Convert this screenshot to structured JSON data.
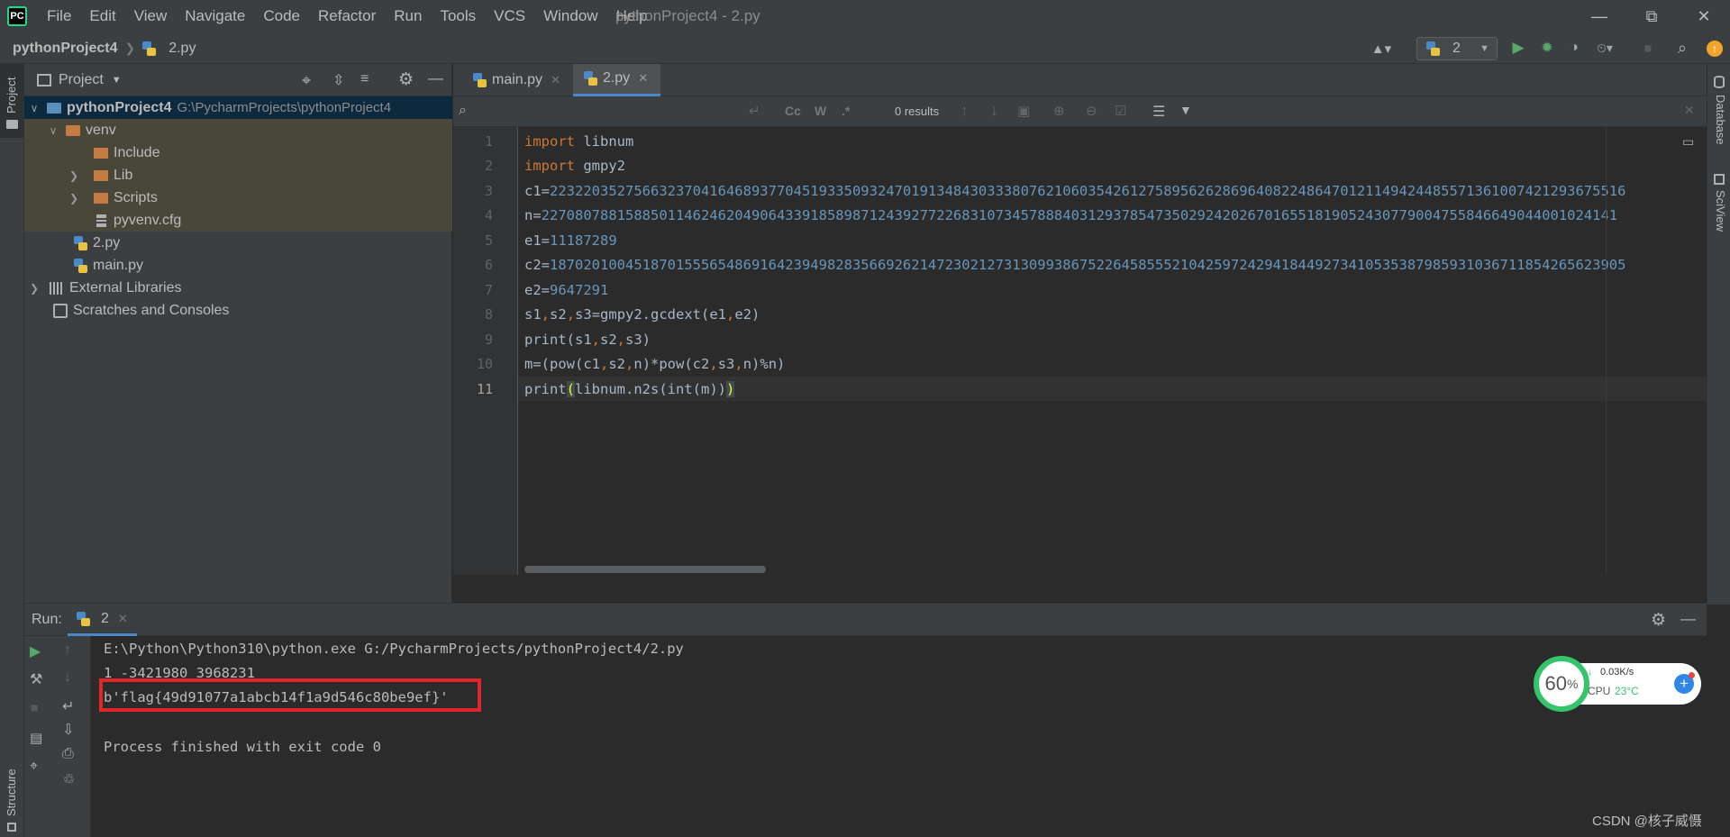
{
  "menu": [
    "File",
    "Edit",
    "View",
    "Navigate",
    "Code",
    "Refactor",
    "Run",
    "Tools",
    "VCS",
    "Window",
    "Help"
  ],
  "window_title": "pythonProject4 - 2.py",
  "breadcrumb": {
    "project": "pythonProject4",
    "file": "2.py"
  },
  "run_config": "2",
  "left_tabs": {
    "project": "Project",
    "structure": "Structure"
  },
  "right_tabs": {
    "database": "Database",
    "sciview": "SciView"
  },
  "project_panel": {
    "title": "Project",
    "tree": [
      {
        "label": "pythonProject4",
        "path": "G:\\PycharmProjects\\pythonProject4"
      },
      {
        "label": "venv"
      },
      {
        "label": "Include"
      },
      {
        "label": "Lib"
      },
      {
        "label": "Scripts"
      },
      {
        "label": "pyvenv.cfg"
      },
      {
        "label": "2.py"
      },
      {
        "label": "main.py"
      },
      {
        "label": "External Libraries"
      },
      {
        "label": "Scratches and Consoles"
      }
    ]
  },
  "editor_tabs": [
    "main.py",
    "2.py"
  ],
  "find": {
    "results": "0 results",
    "cc": "Cc",
    "w": "W",
    "regex": ".*"
  },
  "code": {
    "line_numbers": [
      "1",
      "2",
      "3",
      "4",
      "5",
      "6",
      "7",
      "8",
      "9",
      "10",
      "11"
    ],
    "l1_kw": "import",
    "l1_rest": " libnum",
    "l2_kw": "import",
    "l2_rest": " gmpy2",
    "l3_name": "c1=",
    "l3_val": "22322035275663237041646893770451933509324701913484303338076210603542612758956262869640822486470121149424485571361007421293675516",
    "l4_name": "n=",
    "l4_val": "22708078815885011462462049064339185898712439277226831073457888403129378547350292420267016551819052430779004755846649044001024141",
    "l5_name": "e1=",
    "l5_val": "11187289",
    "l6_name": "c2=",
    "l6_val": "18702010045187015556548691642394982835669262147230212731309938675226458555210425972429418449273410535387985931036711854265623905",
    "l7_name": "e2=",
    "l7_val": "9647291",
    "l8": [
      "s1",
      ",",
      "s2",
      ",",
      "s3=gmpy2.gcdext(e1",
      ",",
      "e2)"
    ],
    "l9": [
      "print(s1",
      ",",
      "s2",
      ",",
      "s3)"
    ],
    "l10": [
      "m=(pow(c1",
      ",",
      "s2",
      ",",
      "n)*pow(c2",
      ",",
      "s3",
      ",",
      "n)%n)"
    ],
    "l11_a": "print",
    "l11_b": "(",
    "l11_c": "libnum.n2s(int(m))",
    "l11_d": ")"
  },
  "run": {
    "label": "Run:",
    "tab": "2",
    "output": [
      "E:\\Python\\Python310\\python.exe G:/PycharmProjects/pythonProject4/2.py",
      "1 -3421980 3968231",
      "b'flag{49d91077a1abcb14f1a9d546c80be9ef}'",
      "",
      "Process finished with exit code 0"
    ]
  },
  "widget": {
    "percent": "60",
    "percent_sign": "%",
    "speed": "0.03K/s",
    "cpu_label": "CPU",
    "cpu_temp": "23°C"
  },
  "watermark": "CSDN @核子威慑"
}
